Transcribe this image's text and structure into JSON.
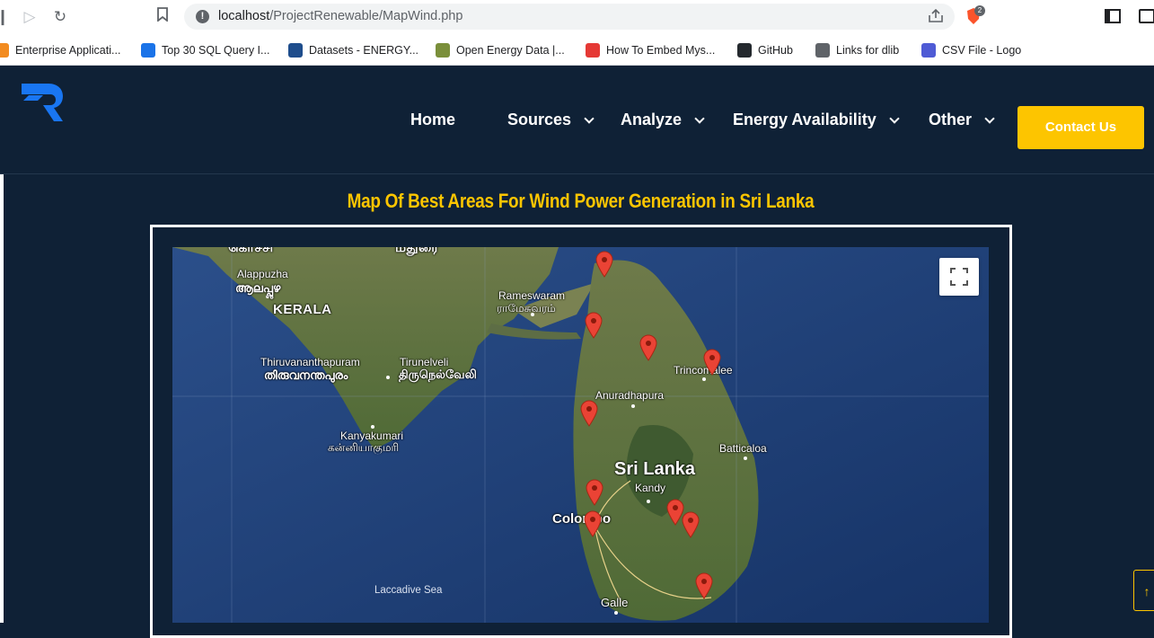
{
  "browser": {
    "url_host": "localhost",
    "url_path": "/ProjectRenewable/MapWind.php",
    "brave_badge": "2",
    "bookmarks": [
      {
        "label": "Enterprise Applicati...",
        "color": "#f28b20"
      },
      {
        "label": "Top 30 SQL Query I...",
        "color": "#1a73e8"
      },
      {
        "label": "Datasets - ENERGY...",
        "color": "#1e4d8c"
      },
      {
        "label": "Open Energy Data |...",
        "color": "#7a8f3a"
      },
      {
        "label": "How To Embed Mys...",
        "color": "#e53935"
      },
      {
        "label": "GitHub",
        "color": "#24292e"
      },
      {
        "label": "Links for dlib",
        "color": "#5f6368"
      },
      {
        "label": "CSV File - Logo",
        "color": "#4f5bd5"
      }
    ]
  },
  "header": {
    "nav": [
      {
        "label": "Home",
        "dropdown": false
      },
      {
        "label": "Sources",
        "dropdown": true
      },
      {
        "label": "Analyze",
        "dropdown": true
      },
      {
        "label": "Energy Availability",
        "dropdown": true
      },
      {
        "label": "Other",
        "dropdown": true
      }
    ],
    "contact_label": "Contact Us",
    "accent_color": "#fdc500",
    "bg_color": "#0f2136"
  },
  "main": {
    "title": "Map Of Best Areas For Wind Power Generation in Sri Lanka",
    "back_to_top": "↑"
  },
  "map": {
    "labels": {
      "top_cut_1": "கொச்சி",
      "top_cut_2": "மதுரை",
      "alappuzha": "Alappuzha",
      "alappuzha_local": "ആലപ്പുഴ",
      "kerala": "KERALA",
      "rameswaram": "Rameswaram",
      "rameswaram_local": "ராமேசுவரம்",
      "thiruvananthapuram": "Thiruvananthapuram",
      "thiruvananthapuram_local": "തിരുവനന്തപുരം",
      "tirunelveli": "Tirunelveli",
      "tirunelveli_local": "திருநெல்வேலி",
      "trincomalee": "Trincomalee",
      "anuradhapura": "Anuradhapura",
      "kanyakumari": "Kanyakumari",
      "kanyakumari_local": "கன்னியாகுமரி",
      "batticaloa": "Batticaloa",
      "sri_lanka": "Sri Lanka",
      "kandy": "Kandy",
      "colombo": "Colombo",
      "laccadive_sea": "Laccadive Sea",
      "galle": "Galle"
    },
    "marker_count": 11,
    "marker_color": "#ea4335"
  }
}
